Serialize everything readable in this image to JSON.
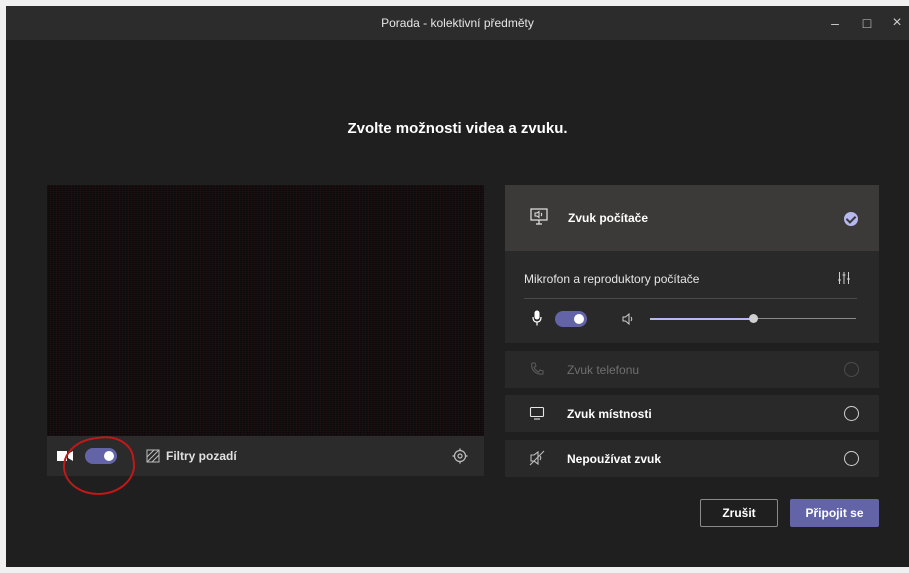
{
  "window": {
    "title": "Porada - kolektivní předměty"
  },
  "heading": "Zvolte možnosti videa a zvuku.",
  "video": {
    "camera_on": true,
    "filters_label": "Filtry pozadí"
  },
  "audio": {
    "computer_label": "Zvuk počítače",
    "devices_label": "Mikrofon a reproduktory počítače",
    "mic_on": true,
    "volume": 0.5,
    "options": [
      {
        "label": "Zvuk telefonu",
        "enabled": false
      },
      {
        "label": "Zvuk místnosti",
        "enabled": true
      },
      {
        "label": "Nepoužívat zvuk",
        "enabled": true
      }
    ]
  },
  "buttons": {
    "cancel": "Zrušit",
    "join": "Připojit se"
  },
  "colors": {
    "accent": "#6264a7",
    "check": "#b7b8f0",
    "annotation": "#c21818"
  },
  "icons": {
    "camera": "video-camera-icon",
    "filters": "background-filters-icon",
    "settings": "gear-icon",
    "computer_audio": "monitor-speaker-icon",
    "device_settings": "equalizer-icon",
    "mic": "microphone-icon",
    "speaker": "speaker-icon",
    "phone": "phone-icon",
    "room": "room-display-icon",
    "no_audio": "no-audio-icon"
  }
}
